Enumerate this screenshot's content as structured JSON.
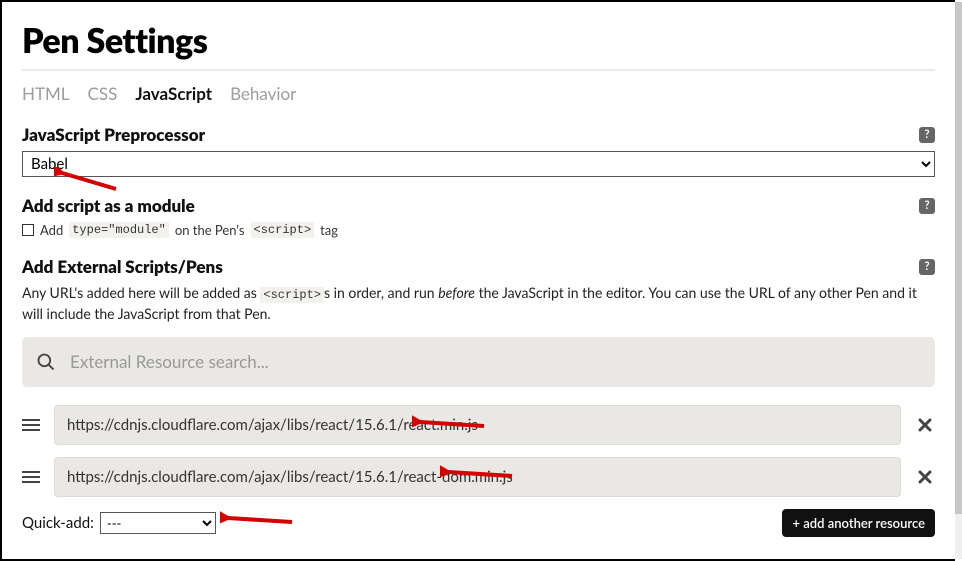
{
  "title": "Pen Settings",
  "tabs": {
    "html": "HTML",
    "css": "CSS",
    "js": "JavaScript",
    "behavior": "Behavior"
  },
  "preprocessor": {
    "label": "JavaScript Preprocessor",
    "value": "Babel"
  },
  "module": {
    "label": "Add script as a module",
    "checkbox_prefix": "Add",
    "code1": "type=\"module\"",
    "mid": "on the Pen's",
    "code2": "<script>",
    "suffix": "tag"
  },
  "external": {
    "label": "Add External Scripts/Pens",
    "desc_a": "Any URL's added here will be added as ",
    "desc_code": "<script>",
    "desc_b": "s in order, and run ",
    "desc_em": "before",
    "desc_c": " the JavaScript in the editor. You can use the URL of any other Pen and it will include the JavaScript from that Pen.",
    "search_placeholder": "External Resource search..."
  },
  "resources": [
    "https://cdnjs.cloudflare.com/ajax/libs/react/15.6.1/react.min.js",
    "https://cdnjs.cloudflare.com/ajax/libs/react/15.6.1/react-dom.min.js"
  ],
  "quick_add": {
    "label": "Quick-add:",
    "value": "---"
  },
  "add_button": "+ add another resource"
}
